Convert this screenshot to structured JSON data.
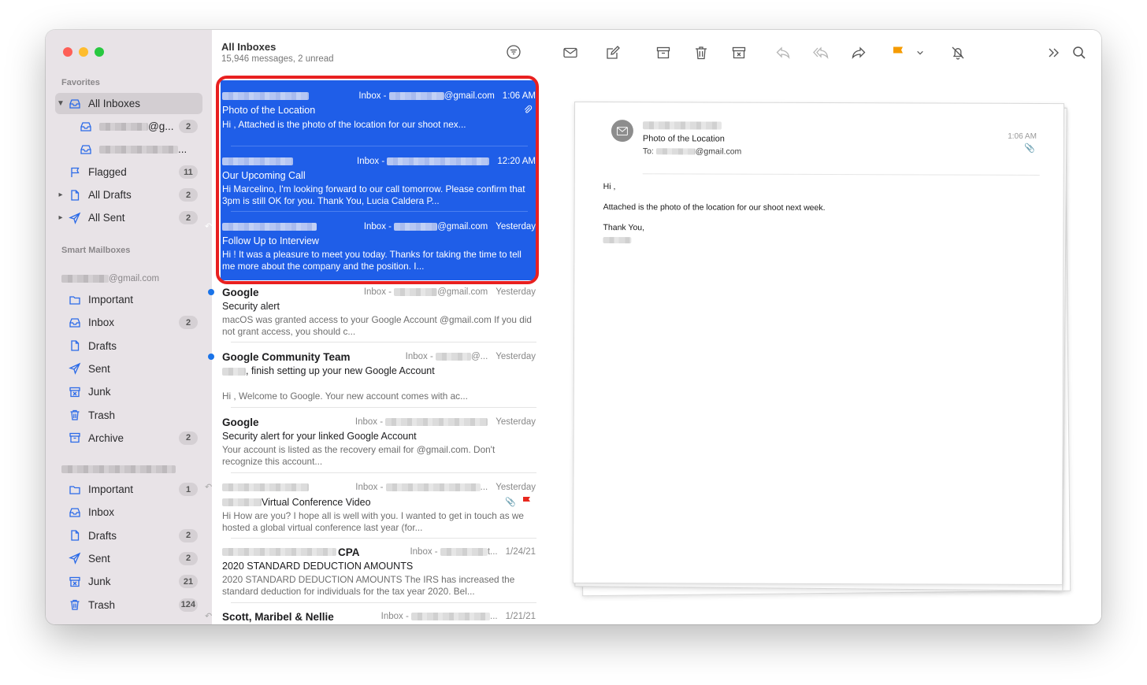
{
  "sidebar": {
    "favorites_title": "Favorites",
    "all_inboxes": "All Inboxes",
    "account_inbox_1_suffix": "@g...",
    "account_inbox_1_badge": "2",
    "account_inbox_2_suffix": "...",
    "flagged": "Flagged",
    "flagged_badge": "11",
    "all_drafts": "All Drafts",
    "all_drafts_badge": "2",
    "all_sent": "All Sent",
    "all_sent_badge": "2",
    "smart_mailboxes_title": "Smart Mailboxes",
    "account1_suffix": "@gmail.com",
    "account1": [
      {
        "label": "Important",
        "icon": "folder-icon",
        "badge": ""
      },
      {
        "label": "Inbox",
        "icon": "tray-icon",
        "badge": "2"
      },
      {
        "label": "Drafts",
        "icon": "document-icon",
        "badge": ""
      },
      {
        "label": "Sent",
        "icon": "paperplane-icon",
        "badge": ""
      },
      {
        "label": "Junk",
        "icon": "junk-icon",
        "badge": ""
      },
      {
        "label": "Trash",
        "icon": "trash-icon",
        "badge": ""
      },
      {
        "label": "Archive",
        "icon": "archive-icon",
        "badge": "2"
      }
    ],
    "account2": [
      {
        "label": "Important",
        "icon": "folder-icon",
        "badge": "1"
      },
      {
        "label": "Inbox",
        "icon": "tray-icon",
        "badge": ""
      },
      {
        "label": "Drafts",
        "icon": "document-icon",
        "badge": "2"
      },
      {
        "label": "Sent",
        "icon": "paperplane-icon",
        "badge": "2"
      },
      {
        "label": "Junk",
        "icon": "junk-icon",
        "badge": "21"
      },
      {
        "label": "Trash",
        "icon": "trash-icon",
        "badge": "124"
      }
    ]
  },
  "list": {
    "title": "All Inboxes",
    "subtitle": "15,946 messages, 2 unread",
    "messages": [
      {
        "sender": "",
        "mailbox": "Inbox -",
        "mailbox_suffix": "@gmail.com",
        "date": "1:06 AM",
        "subject": "Photo of the Location",
        "preview": "Hi , Attached is the photo of the location for our shoot nex...",
        "selected": true
      },
      {
        "sender": "",
        "mailbox": "Inbox -",
        "mailbox_suffix": "",
        "date": "12:20 AM",
        "subject": "Our Upcoming Call",
        "preview": "Hi Marcelino, I'm looking forward to our call tomorrow. Please confirm that 3pm is still OK for you. Thank You, Lucia Caldera P...",
        "selected": true
      },
      {
        "sender": "",
        "mailbox": "Inbox -",
        "mailbox_suffix": "@gmail.com",
        "date": "Yesterday",
        "subject": "Follow Up to Interview",
        "preview": "Hi ! It was a pleasure to meet you today. Thanks for taking the time to tell me more about the company and the position. I...",
        "selected": true
      },
      {
        "sender": "Google",
        "mailbox": "Inbox -",
        "mailbox_suffix": "@gmail.com",
        "date": "Yesterday",
        "subject": "Security alert",
        "preview": "macOS was granted access to your Google Account @gmail.com If you did not grant access, you should c..."
      },
      {
        "sender": "Google Community Team",
        "mailbox": "Inbox -",
        "mailbox_suffix": "@...",
        "date": "Yesterday",
        "subject": ", finish setting up your new Google Account",
        "preview": "Hi , Welcome to Google. Your new account comes with ac..."
      },
      {
        "sender": "Google",
        "mailbox": "Inbox -",
        "mailbox_suffix": "",
        "date": "Yesterday",
        "subject": "Security alert for your linked Google Account",
        "preview": "Your account is listed as the recovery email for @gmail.com. Don't recognize this account..."
      },
      {
        "sender": "",
        "mailbox": "Inbox -",
        "mailbox_suffix": "...",
        "date": "Yesterday",
        "subject": "Virtual Conference Video",
        "preview": "Hi How are you? I hope all is well with you. I wanted to get in touch as we hosted a global virtual conference last year (for..."
      },
      {
        "sender": "CPA",
        "mailbox": "Inbox -",
        "mailbox_suffix": "t...",
        "date": "1/24/21",
        "subject": "2020 STANDARD DEDUCTION AMOUNTS",
        "preview": "2020 STANDARD DEDUCTION AMOUNTS The IRS has increased the standard deduction for individuals for the tax year 2020. Bel..."
      },
      {
        "sender": "Scott, Maribel & Nellie",
        "mailbox": "Inbox -",
        "mailbox_suffix": "...",
        "date": "1/21/21",
        "subject": "",
        "preview": ""
      }
    ]
  },
  "reader": {
    "subject": "Photo of the Location",
    "to_label": "To:",
    "to_suffix": "@gmail.com",
    "time": "1:06 AM",
    "greeting": "Hi ,",
    "body": "Attached is the photo of the location for our shoot next week.",
    "signoff": "Thank You,"
  },
  "colors": {
    "selection": "#1f5ee8",
    "highlight_border": "#e82020",
    "unread_dot": "#1a73e8",
    "flag": "#f59b00"
  }
}
